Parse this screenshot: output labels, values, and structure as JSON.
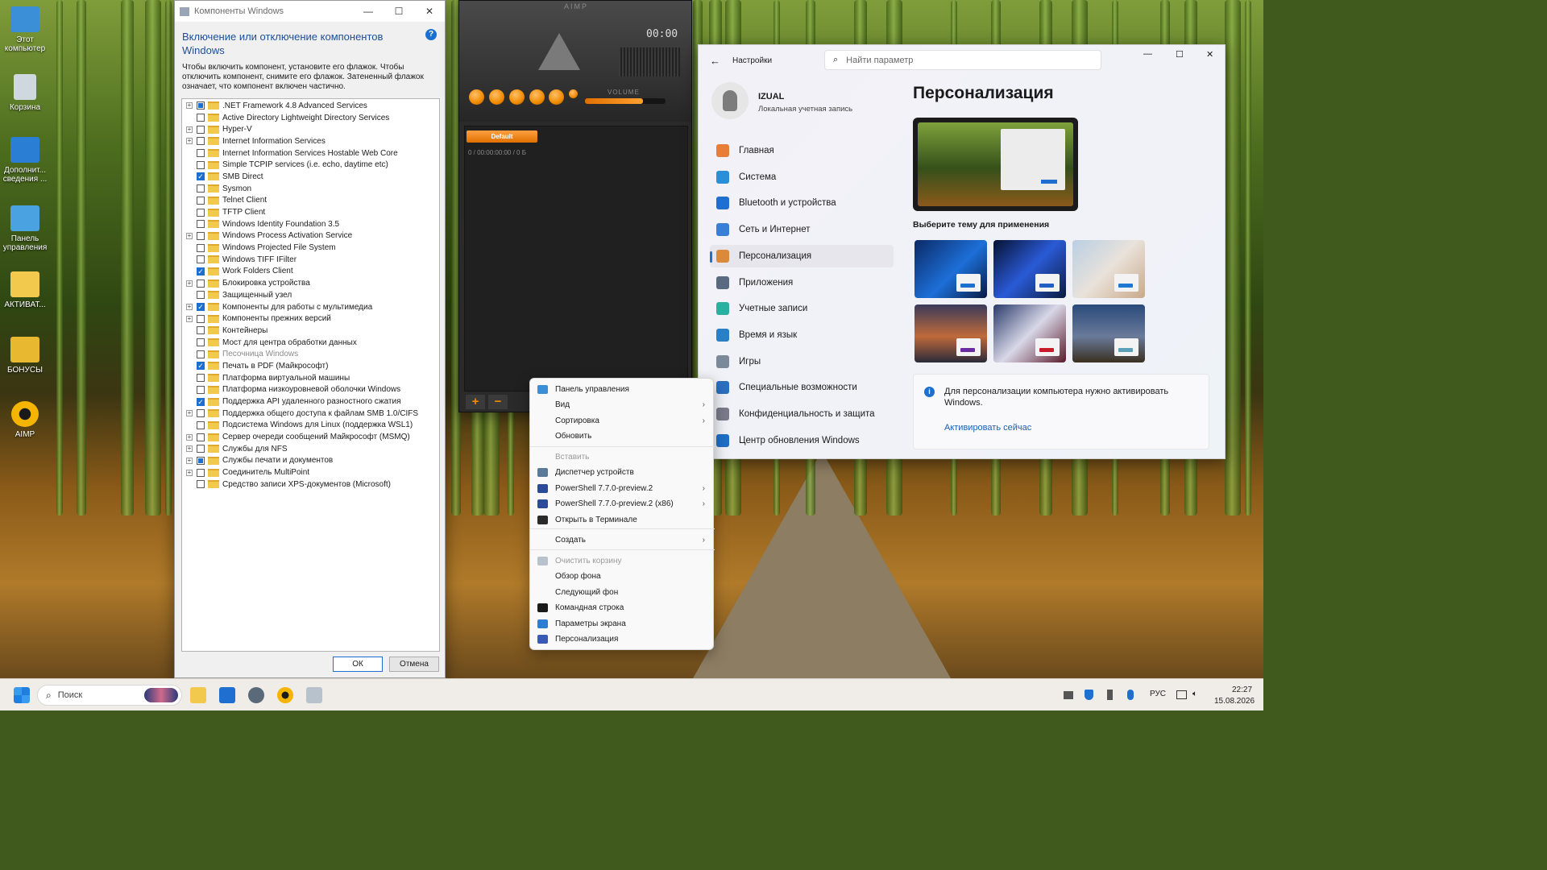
{
  "desktop": {
    "icons": [
      {
        "label": "Этот компьютер",
        "icon": "monitor-icon",
        "color": "#3a8fd6"
      },
      {
        "label": "Корзина",
        "icon": "recycle-bin-icon",
        "color": "#cfd8de"
      },
      {
        "label": "Дополнит... сведения ...",
        "icon": "info-photo-icon",
        "color": "#2a7fd4"
      },
      {
        "label": "Панель управления",
        "icon": "control-panel-icon",
        "color": "#4aa3e0"
      },
      {
        "label": "АКТИВАТ...",
        "icon": "folder-icon",
        "color": "#f2c94c"
      },
      {
        "label": "БОНУСЫ",
        "icon": "folder-icon",
        "color": "#e8b830"
      },
      {
        "label": "AIMP",
        "icon": "aimp-icon",
        "color": "#f5b400"
      }
    ]
  },
  "components": {
    "window_title": "Компоненты Windows",
    "heading": "Включение или отключение компонентов Windows",
    "description": "Чтобы включить компонент, установите его флажок. Чтобы отключить компонент, снимите его флажок. Затененный флажок означает, что компонент включен частично.",
    "items": [
      {
        "label": ".NET Framework 4.8 Advanced Services",
        "state": "partial",
        "expand": true
      },
      {
        "label": "Active Directory Lightweight Directory Services",
        "state": "off",
        "expand": false
      },
      {
        "label": "Hyper-V",
        "state": "off",
        "expand": true
      },
      {
        "label": "Internet Information Services",
        "state": "off",
        "expand": true
      },
      {
        "label": "Internet Information Services Hostable Web Core",
        "state": "off",
        "expand": false
      },
      {
        "label": "Simple TCPIP services (i.e. echo, daytime etc)",
        "state": "off",
        "expand": false
      },
      {
        "label": "SMB Direct",
        "state": "on",
        "expand": false
      },
      {
        "label": "Sysmon",
        "state": "off",
        "expand": false
      },
      {
        "label": "Telnet Client",
        "state": "off",
        "expand": false
      },
      {
        "label": "TFTP Client",
        "state": "off",
        "expand": false
      },
      {
        "label": "Windows Identity Foundation 3.5",
        "state": "off",
        "expand": false
      },
      {
        "label": "Windows Process Activation Service",
        "state": "off",
        "expand": true
      },
      {
        "label": "Windows Projected File System",
        "state": "off",
        "expand": false
      },
      {
        "label": "Windows TIFF IFilter",
        "state": "off",
        "expand": false
      },
      {
        "label": "Work Folders Client",
        "state": "on",
        "expand": false
      },
      {
        "label": "Блокировка устройства",
        "state": "off",
        "expand": true
      },
      {
        "label": "Защищенный узел",
        "state": "off",
        "expand": false
      },
      {
        "label": "Компоненты для работы с мультимедиа",
        "state": "on",
        "expand": true
      },
      {
        "label": "Компоненты прежних версий",
        "state": "off",
        "expand": true
      },
      {
        "label": "Контейнеры",
        "state": "off",
        "expand": false
      },
      {
        "label": "Мост для центра обработки данных",
        "state": "off",
        "expand": false
      },
      {
        "label": "Песочница Windows",
        "state": "off",
        "expand": false,
        "dim": true
      },
      {
        "label": "Печать в PDF (Майкрософт)",
        "state": "on",
        "expand": false
      },
      {
        "label": "Платформа виртуальной машины",
        "state": "off",
        "expand": false
      },
      {
        "label": "Платформа низкоуровневой оболочки Windows",
        "state": "off",
        "expand": false
      },
      {
        "label": "Поддержка API удаленного разностного сжатия",
        "state": "on",
        "expand": false
      },
      {
        "label": "Поддержка общего доступа к файлам SMB 1.0/CIFS",
        "state": "off",
        "expand": true
      },
      {
        "label": "Подсистема Windows для Linux (поддержка WSL1)",
        "state": "off",
        "expand": false
      },
      {
        "label": "Сервер очереди сообщений Майкрософт (MSMQ)",
        "state": "off",
        "expand": true
      },
      {
        "label": "Службы для NFS",
        "state": "off",
        "expand": true
      },
      {
        "label": "Службы печати и документов",
        "state": "partial",
        "expand": true
      },
      {
        "label": "Соединитель MultiPoint",
        "state": "off",
        "expand": true
      },
      {
        "label": "Средство записи XPS-документов (Microsoft)",
        "state": "off",
        "expand": false
      }
    ],
    "ok_label": "ОК",
    "cancel_label": "Отмена"
  },
  "aimp": {
    "title": "AIMP",
    "time": "00:00",
    "volume_label": "VOLUME",
    "volume_level": 0.72,
    "playlist_tab": "Default",
    "playlist_info": "0 / 00:00:00:00 / 0 Б"
  },
  "settings": {
    "app_title": "Настройки",
    "search_placeholder": "Найти параметр",
    "user_name": "IZUAL",
    "user_type": "Локальная учетная запись",
    "page_title": "Персонализация",
    "theme_prompt": "Выберите тему для применения",
    "nav": [
      {
        "label": "Главная",
        "icon": "home-icon",
        "color": "#e67e3a"
      },
      {
        "label": "Система",
        "icon": "system-icon",
        "color": "#2a8fd6"
      },
      {
        "label": "Bluetooth и устройства",
        "icon": "bluetooth-icon",
        "color": "#1f6fd1"
      },
      {
        "label": "Сеть и Интернет",
        "icon": "network-icon",
        "color": "#3a7fd6"
      },
      {
        "label": "Персонализация",
        "icon": "brush-icon",
        "color": "#d98a3a"
      },
      {
        "label": "Приложения",
        "icon": "apps-icon",
        "color": "#5a6a80"
      },
      {
        "label": "Учетные записи",
        "icon": "accounts-icon",
        "color": "#2ab0a0"
      },
      {
        "label": "Время и язык",
        "icon": "time-language-icon",
        "color": "#2a80c6"
      },
      {
        "label": "Игры",
        "icon": "gaming-icon",
        "color": "#7a8a9a"
      },
      {
        "label": "Специальные возможности",
        "icon": "accessibility-icon",
        "color": "#2a70c0"
      },
      {
        "label": "Конфиденциальность и защита",
        "icon": "shield-icon",
        "color": "#7a7a8a"
      },
      {
        "label": "Центр обновления Windows",
        "icon": "update-icon",
        "color": "#1f70c6"
      }
    ],
    "themes": [
      {
        "bg": "linear-gradient(135deg,#0b2a66,#1d6fd8 55%,#071a44)",
        "accent": "#1f6fd1"
      },
      {
        "bg": "linear-gradient(135deg,#061233,#2a5ad6 50%,#0a1a40)",
        "accent": "#1f5fc6"
      },
      {
        "bg": "linear-gradient(135deg,#b9cfe4,#e9e2da 50%,#c9a98a)",
        "accent": "#1f78d1"
      },
      {
        "bg": "linear-gradient(180deg,#3a3a5a,#c06a3a 55%,#2a2a3a)",
        "accent": "#6a2aa0"
      },
      {
        "bg": "linear-gradient(135deg,#2a3a6a,#d8d8e8 50%,#5a1a2a)",
        "accent": "#c81a2a"
      },
      {
        "bg": "linear-gradient(180deg,#2a4a7a,#6a7a9a 55%,#3a3020)",
        "accent": "#5aa0b8"
      }
    ],
    "activation_text": "Для персонализации компьютера нужно активировать Windows.",
    "activation_link": "Активировать сейчас"
  },
  "context_menu": {
    "items": [
      {
        "label": "Панель управления",
        "icon": "control-panel-icon",
        "arrow": false,
        "disabled": false
      },
      {
        "label": "Вид",
        "icon": "",
        "arrow": true,
        "disabled": false
      },
      {
        "label": "Сортировка",
        "icon": "",
        "arrow": true,
        "disabled": false
      },
      {
        "label": "Обновить",
        "icon": "",
        "arrow": false,
        "disabled": false
      },
      {
        "label": "Вставить",
        "icon": "",
        "arrow": false,
        "disabled": true
      },
      {
        "label": "Диспетчер устройств",
        "icon": "device-manager-icon",
        "arrow": false,
        "disabled": false
      },
      {
        "label": "PowerShell 7.7.0-preview.2",
        "icon": "powershell-icon",
        "arrow": true,
        "disabled": false
      },
      {
        "label": "PowerShell 7.7.0-preview.2 (x86)",
        "icon": "powershell-icon",
        "arrow": true,
        "disabled": false
      },
      {
        "label": "Открыть в Терминале",
        "icon": "terminal-icon",
        "arrow": false,
        "disabled": false
      },
      {
        "label": "Создать",
        "icon": "",
        "arrow": true,
        "disabled": false
      },
      {
        "label": "Очистить корзину",
        "icon": "recycle-bin-icon",
        "arrow": false,
        "disabled": true
      },
      {
        "label": "Обзор фона",
        "icon": "",
        "arrow": false,
        "disabled": false
      },
      {
        "label": "Следующий фон",
        "icon": "",
        "arrow": false,
        "disabled": false
      },
      {
        "label": "Командная строка",
        "icon": "cmd-icon",
        "arrow": false,
        "disabled": false
      },
      {
        "label": "Параметры экрана",
        "icon": "display-settings-icon",
        "arrow": false,
        "disabled": false
      },
      {
        "label": "Персонализация",
        "icon": "personalization-icon",
        "arrow": false,
        "disabled": false
      }
    ]
  },
  "taskbar": {
    "search_placeholder": "Поиск",
    "language": "РУС",
    "time": "22:27",
    "date": "15.08.2026"
  }
}
